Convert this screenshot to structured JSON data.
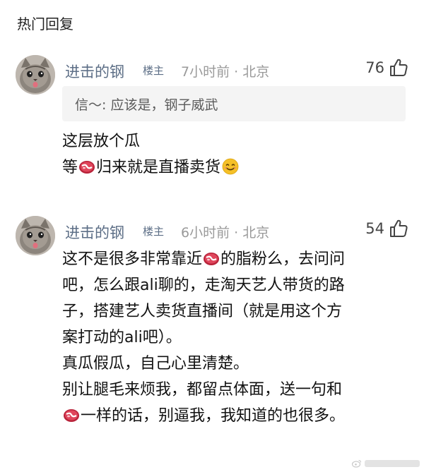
{
  "section_title": "热门回复",
  "colors": {
    "username": "#5c6e86",
    "meta": "#9a9a9a",
    "quote_bg": "#f4f4f4"
  },
  "comments": [
    {
      "avatar": "cat-avatar",
      "username": "进击的钢",
      "badge": "楼主",
      "time": "7小时前",
      "location": "北京",
      "likes": "76",
      "quote": "信～: 应该是，钢子威武",
      "lines": [
        [
          "这层放个瓜"
        ],
        [
          "等",
          "steak-emoji",
          "归来就是直播卖货",
          "smiley-emoji"
        ]
      ]
    },
    {
      "avatar": "cat-avatar",
      "username": "进击的钢",
      "badge": "楼主",
      "time": "6小时前",
      "location": "北京",
      "likes": "54",
      "lines": [
        [
          "这不是很多非常靠近",
          "steak-emoji",
          "的脂粉么，去问问"
        ],
        [
          "吧，怎么跟ali聊的，走淘天艺人带货的路"
        ],
        [
          "子，搭建艺人卖货直播间（就是用这个方"
        ],
        [
          "案打动的ali吧）。"
        ],
        [
          "真瓜假瓜，自己心里清楚。"
        ],
        [
          "别让腿毛来烦我，都留点体面，送一句和"
        ],
        [
          "steak-emoji",
          "一样的话，别逼我，我知道的也很多。"
        ]
      ]
    }
  ],
  "meta_separator": "·"
}
